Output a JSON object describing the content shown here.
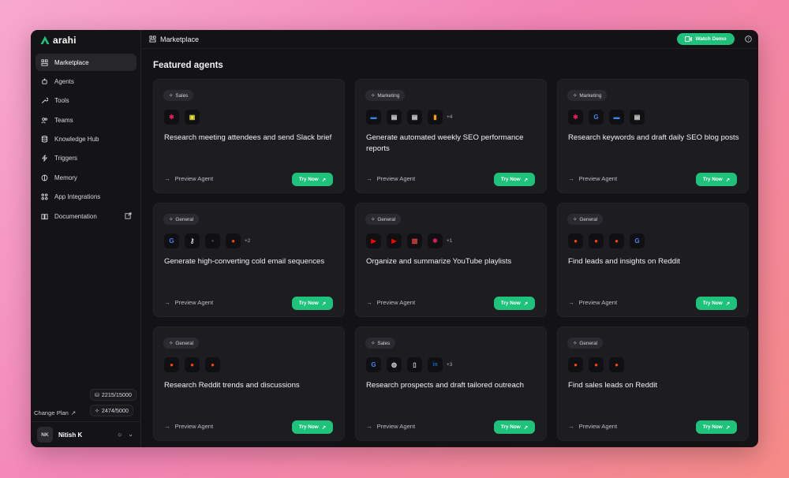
{
  "app": {
    "logo_text": "arahi",
    "header_title": "Marketplace",
    "watch_demo_label": "Watch Demo"
  },
  "sidebar": {
    "items": [
      {
        "label": "Marketplace",
        "icon": "marketplace-icon"
      },
      {
        "label": "Agents",
        "icon": "agents-icon"
      },
      {
        "label": "Tools",
        "icon": "tools-icon"
      },
      {
        "label": "Teams",
        "icon": "teams-icon"
      },
      {
        "label": "Knowledge Hub",
        "icon": "database-icon"
      },
      {
        "label": "Triggers",
        "icon": "bolt-icon"
      },
      {
        "label": "Memory",
        "icon": "brain-icon"
      },
      {
        "label": "App Integrations",
        "icon": "grid-icon"
      },
      {
        "label": "Documentation",
        "icon": "book-icon"
      }
    ],
    "credits_a": "2215/15000",
    "credits_b": "2474/5000",
    "change_plan": "Change Plan",
    "user_initials": "NK",
    "user_name": "Nitish K"
  },
  "main": {
    "section_title": "Featured agents",
    "preview_label": "Preview Agent",
    "try_label": "Try Now",
    "cards": [
      {
        "category": "Sales",
        "title": "Research meeting attendees and send Slack brief",
        "icons": [
          "slack-icon",
          "chip-icon"
        ],
        "more": ""
      },
      {
        "category": "Marketing",
        "title": "Generate automated weekly SEO performance reports",
        "icons": [
          "blue-app-icon",
          "doc-icon",
          "doc-icon",
          "analytics-icon"
        ],
        "more": "+4"
      },
      {
        "category": "Marketing",
        "title": "Research keywords and draft daily SEO blog posts",
        "icons": [
          "slack-icon",
          "google-icon",
          "blue-app-icon",
          "doc-icon"
        ],
        "more": ""
      },
      {
        "category": "General",
        "title": "Generate high-converting cold email sequences",
        "icons": [
          "google-icon",
          "key-icon",
          "dot-icon",
          "reddit-icon"
        ],
        "more": "+2"
      },
      {
        "category": "General",
        "title": "Organize and summarize YouTube playlists",
        "icons": [
          "youtube-icon",
          "youtube-icon",
          "red-doc-icon",
          "slack-icon"
        ],
        "more": "+1"
      },
      {
        "category": "General",
        "title": "Find leads and insights on Reddit",
        "icons": [
          "reddit-icon",
          "reddit-icon",
          "reddit-icon",
          "google-icon"
        ],
        "more": ""
      },
      {
        "category": "General",
        "title": "Research Reddit trends and discussions",
        "icons": [
          "reddit-icon",
          "reddit-icon",
          "reddit-icon"
        ],
        "more": ""
      },
      {
        "category": "Sales",
        "title": "Research prospects and draft tailored outreach",
        "icons": [
          "google-icon",
          "globe-icon",
          "file-icon",
          "linkedin-icon"
        ],
        "more": "+3"
      },
      {
        "category": "General",
        "title": "Find sales leads on Reddit",
        "icons": [
          "reddit-icon",
          "reddit-icon",
          "reddit-icon"
        ],
        "more": ""
      }
    ]
  },
  "colors": {
    "accent": "#1fc27a",
    "background": "#131316",
    "card": "#1c1c21"
  }
}
